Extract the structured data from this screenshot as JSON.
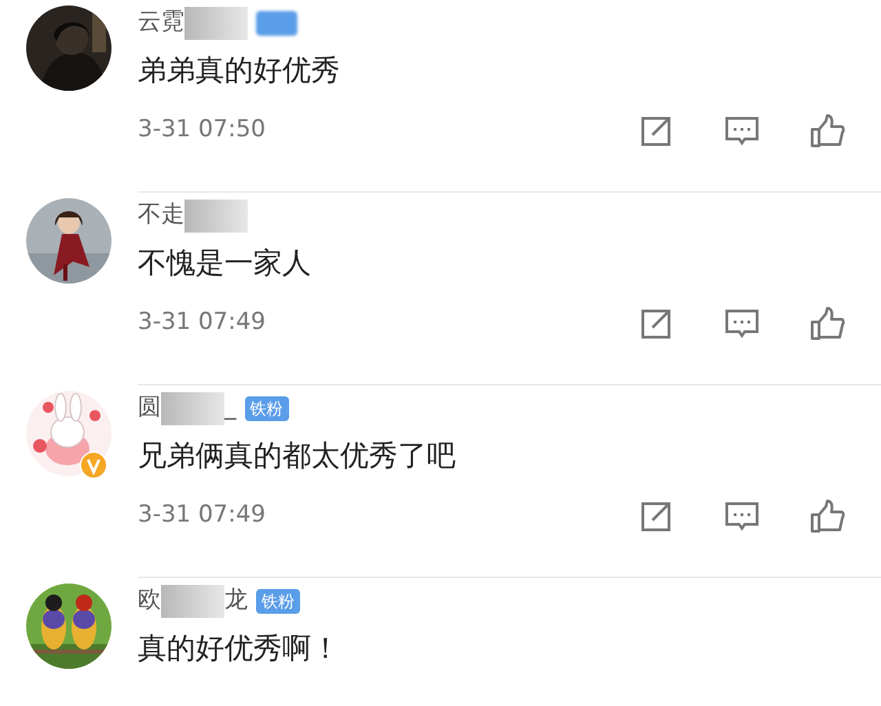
{
  "comments": [
    {
      "verified": false,
      "name_start": "云霓",
      "badge": {
        "kind": "blurred"
      },
      "text": "弟弟真的好优秀",
      "time": "3-31 07:50"
    },
    {
      "verified": false,
      "name_start": "不走",
      "text": "不愧是一家人",
      "time": "3-31 07:49"
    },
    {
      "verified": true,
      "name_start": "圆",
      "name_end": "_",
      "badge": {
        "kind": "text",
        "text": "铁粉"
      },
      "text": "兄弟俩真的都太优秀了吧",
      "time": "3-31 07:49"
    },
    {
      "verified": false,
      "name_start": "欧",
      "name_end": "龙",
      "badge": {
        "kind": "text",
        "text": "铁粉"
      },
      "text": "真的好优秀啊！"
    }
  ]
}
